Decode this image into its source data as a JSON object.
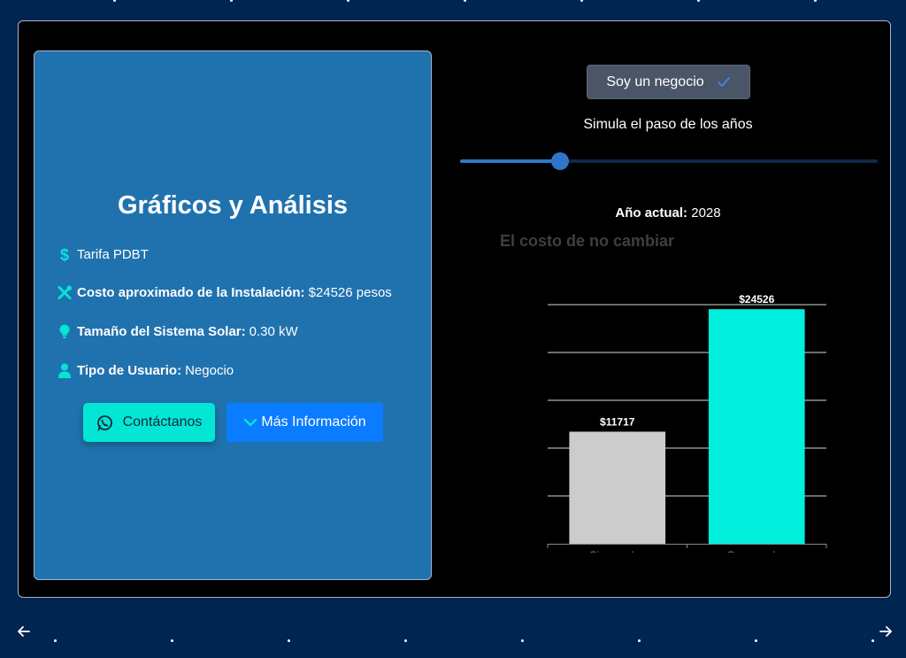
{
  "card": {
    "title": "Gráficos y Análisis",
    "tariff": "Tarifa PDBT",
    "cost_label": "Costo aproximado de la Instalación:",
    "cost_value": "$24526 pesos",
    "size_label": "Tamaño del Sistema Solar:",
    "size_value": "0.30 kW",
    "user_label": "Tipo de Usuario:",
    "user_value": "Negocio",
    "contact_button": "Contáctanos",
    "more_button": "Más Información"
  },
  "controls": {
    "toggle_label": "Soy un negocio",
    "slider_label": "Simula el paso de los años",
    "slider_fraction": 0.24,
    "year_label": "Año actual:",
    "year_value": "2028"
  },
  "colors": {
    "accent": "#03e6d6",
    "primary": "#0a7cff",
    "card": "#2072ae",
    "bar_sin": "#cccccc",
    "bar_con": "#00efdc"
  },
  "icons": {
    "tariff": "dollar-icon",
    "cost": "tools-icon",
    "size": "lightbulb-icon",
    "user": "user-icon",
    "contact": "whatsapp-icon",
    "more": "chevron-down-icon",
    "toggle": "check-icon",
    "prev": "arrow-left-icon",
    "next": "arrow-right-icon"
  },
  "chart_data": {
    "type": "bar",
    "title": "El costo de no cambiar",
    "categories": [
      "Sin paneles",
      "Con paneles"
    ],
    "values": [
      11717,
      24526
    ],
    "value_labels": [
      "$11717",
      "$24526"
    ],
    "ylim": [
      0,
      25000
    ],
    "grid": true,
    "y_ticks_shown": false
  }
}
